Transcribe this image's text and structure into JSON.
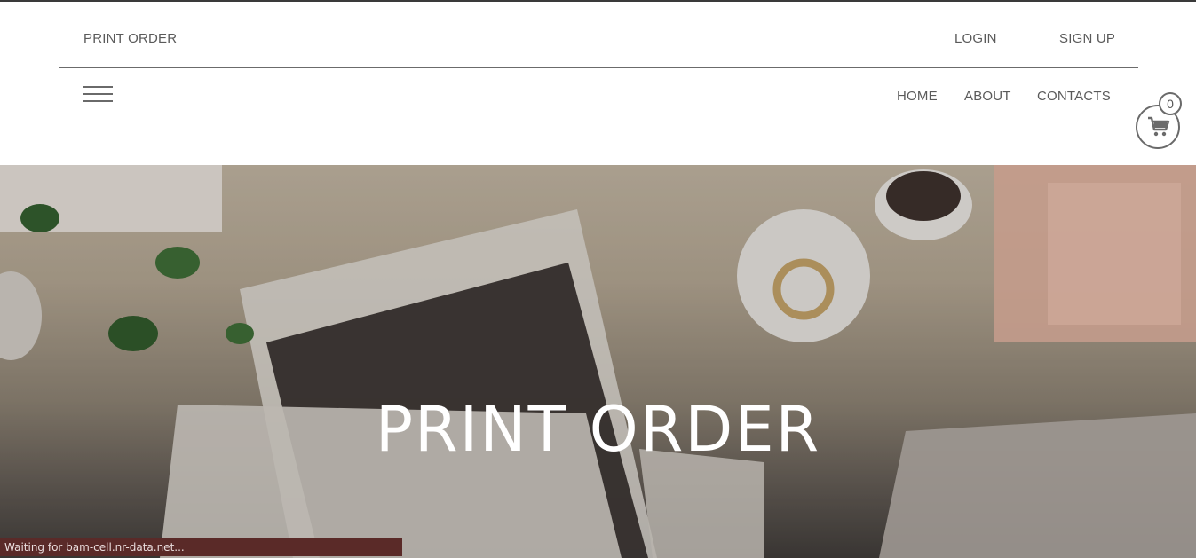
{
  "header": {
    "brand": "PRINT ORDER",
    "login_label": "LOGIN",
    "signup_label": "SIGN UP",
    "nav": {
      "home": "HOME",
      "about": "ABOUT",
      "contacts": "CONTACTS"
    },
    "cart_count": "0",
    "menu_icon": "hamburger-menu-icon",
    "cart_icon": "shopping-cart-icon"
  },
  "hero": {
    "title": "PRINT ORDER"
  },
  "status_bar": {
    "text": "Waiting for bam-cell.nr-data.net..."
  },
  "colors": {
    "text": "#5a5a5a",
    "rule": "#6b6b6b",
    "status_bg": "#5a2a28",
    "hero_title": "#ffffff"
  }
}
